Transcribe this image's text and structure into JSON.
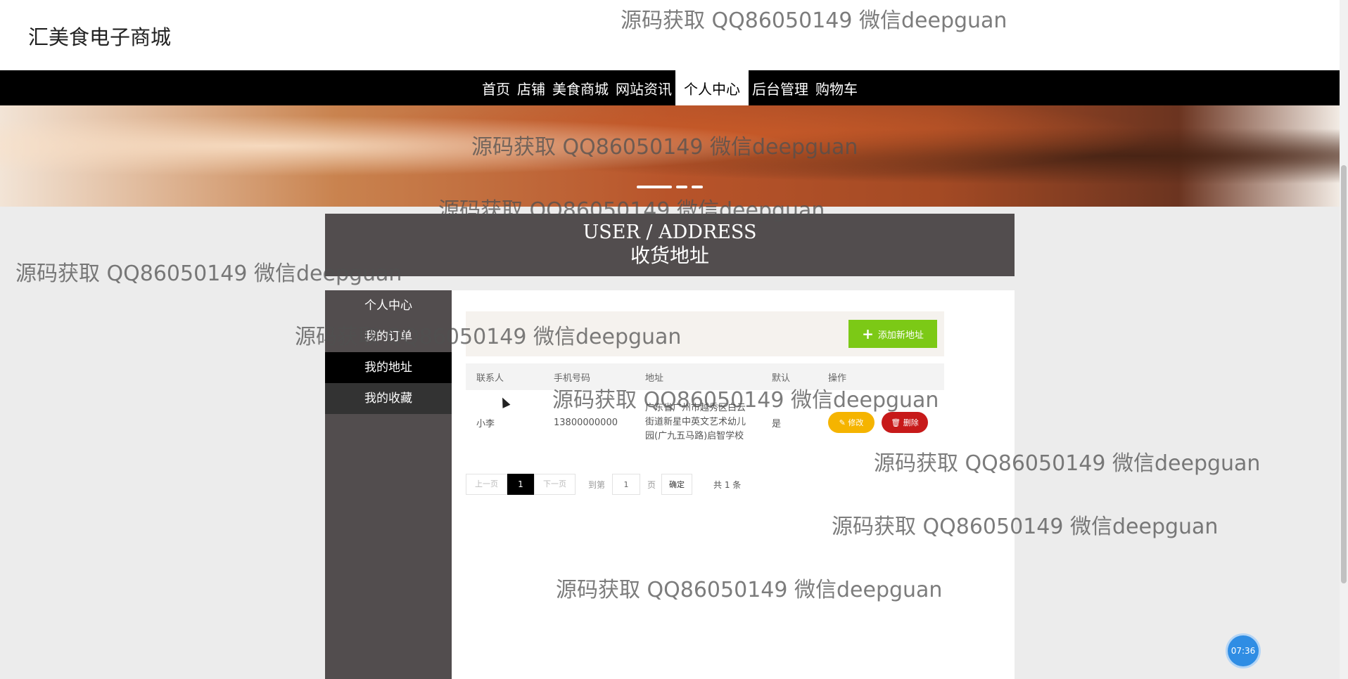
{
  "header": {
    "logo": "汇美食电子商城"
  },
  "nav": {
    "items": [
      "首页",
      "店铺",
      "美食商城",
      "网站资讯",
      "个人中心",
      "后台管理",
      "购物车"
    ],
    "active_index": 4
  },
  "page_title": {
    "en": "USER / ADDRESS",
    "cn": "收货地址"
  },
  "sidebar": {
    "items": [
      "个人中心",
      "我的订单",
      "我的地址",
      "我的收藏"
    ],
    "active_index": 2
  },
  "toolbar": {
    "add_label": "添加新地址"
  },
  "table": {
    "headers": [
      "联系人",
      "手机号码",
      "地址",
      "默认",
      "操作"
    ],
    "rows": [
      {
        "contact": "小李",
        "phone": "13800000000",
        "address": "广东省广州市越秀区白云街道新星中英文艺术幼儿园(广九五马路)启智学校",
        "is_default": "是",
        "edit_label": "修改",
        "delete_label": "删除"
      }
    ]
  },
  "pager": {
    "prev": "上一页",
    "current": "1",
    "next": "下一页",
    "goto_prefix": "到第",
    "goto_value": "1",
    "goto_suffix": "页",
    "confirm": "确定",
    "total": "共 1 条"
  },
  "watermark": "源码获取 QQ86050149 微信deepguan",
  "clock": "07:36",
  "colors": {
    "nav_bg": "#000000",
    "title_bg": "#524d4e",
    "add_button": "#7cc916",
    "edit_button": "#f5b400",
    "delete_button": "#c71a1a",
    "clock": "#2f8de4"
  }
}
